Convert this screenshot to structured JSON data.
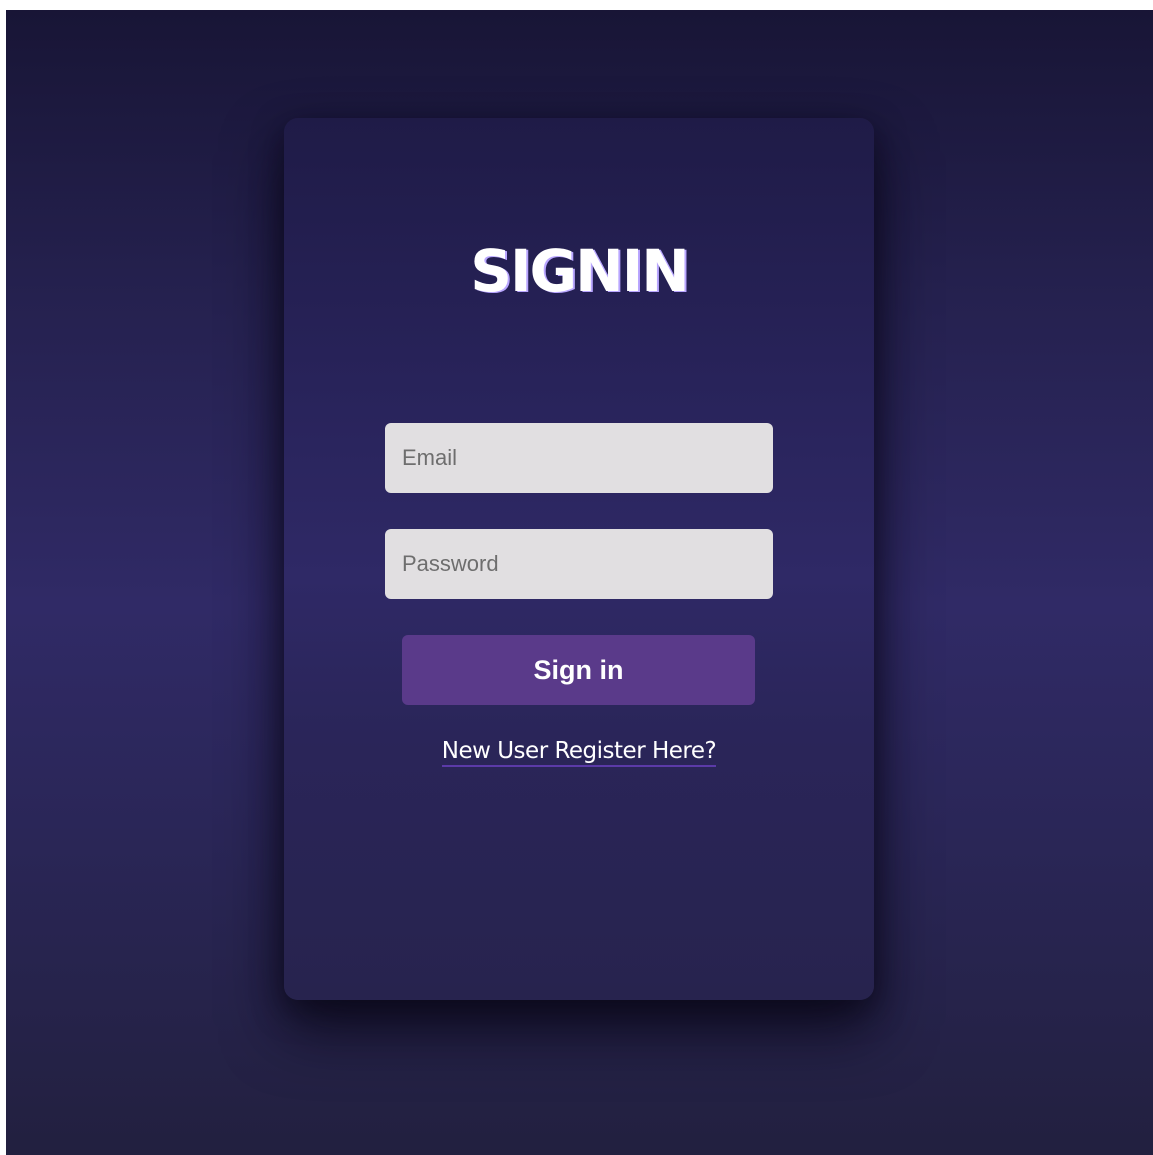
{
  "page": {
    "title": "SIGNIN"
  },
  "form": {
    "email_placeholder": "Email",
    "password_placeholder": "Password",
    "submit_label": "Sign in",
    "register_link": "New User Register Here?"
  },
  "colors": {
    "background_top": "#181536",
    "background_mid": "#302a66",
    "card": "#28235a",
    "input_bg": "#e1dfe1",
    "button_bg": "#5a3a8a",
    "link_underline": "#5b3aa8",
    "text": "#ffffff"
  }
}
